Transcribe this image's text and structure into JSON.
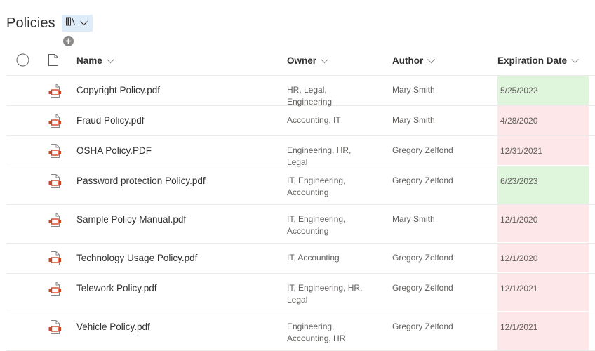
{
  "page": {
    "title": "Policies",
    "view_switch_icon": "library-icon",
    "add_column_icon": "plus-circle-icon"
  },
  "colors": {
    "expired": "#fde7e9",
    "valid": "#dff6dd",
    "view_switch_bg": "#deecf9",
    "pdf_accent": "#d04423"
  },
  "columns": {
    "select": "select-all",
    "type": "file-type",
    "name": "Name",
    "owner": "Owner",
    "author": "Author",
    "expiration": "Expiration Date"
  },
  "rows": [
    {
      "name": "Copyright Policy.pdf",
      "owner": "HR, Legal, Engineering",
      "owner_lines": [
        "HR, Legal, Engineering"
      ],
      "author": "Mary Smith",
      "expiration": "5/25/2022",
      "status": "valid"
    },
    {
      "name": "Fraud Policy.pdf",
      "owner": "Accounting, IT",
      "owner_lines": [
        "Accounting, IT"
      ],
      "author": "Mary Smith",
      "expiration": "4/28/2020",
      "status": "expired"
    },
    {
      "name": "OSHA Policy.PDF",
      "owner": "Engineering, HR, Legal",
      "owner_lines": [
        "Engineering, HR, Legal"
      ],
      "author": "Gregory Zelfond",
      "expiration": "12/31/2021",
      "status": "expired"
    },
    {
      "name": "Password protection Policy.pdf",
      "owner": "IT, Engineering, Accounting",
      "owner_lines": [
        "IT, Engineering,",
        "Accounting"
      ],
      "author": "Gregory Zelfond",
      "expiration": "6/23/2023",
      "status": "valid"
    },
    {
      "name": "Sample Policy Manual.pdf",
      "owner": "IT, Engineering, Accounting",
      "owner_lines": [
        "IT, Engineering,",
        "Accounting"
      ],
      "author": "Mary Smith",
      "expiration": "12/1/2020",
      "status": "expired"
    },
    {
      "name": "Technology Usage Policy.pdf",
      "owner": "IT, Accounting",
      "owner_lines": [
        "IT, Accounting"
      ],
      "author": "Gregory Zelfond",
      "expiration": "12/1/2020",
      "status": "expired"
    },
    {
      "name": "Telework Policy.pdf",
      "owner": "IT, Engineering, HR, Legal",
      "owner_lines": [
        "IT, Engineering, HR,",
        "Legal"
      ],
      "author": "Gregory Zelfond",
      "expiration": "12/1/2021",
      "status": "expired"
    },
    {
      "name": "Vehicle Policy.pdf",
      "owner": "Engineering, Accounting, HR",
      "owner_lines": [
        "Engineering,",
        "Accounting, HR"
      ],
      "author": "Gregory Zelfond",
      "expiration": "12/1/2021",
      "status": "expired"
    }
  ]
}
